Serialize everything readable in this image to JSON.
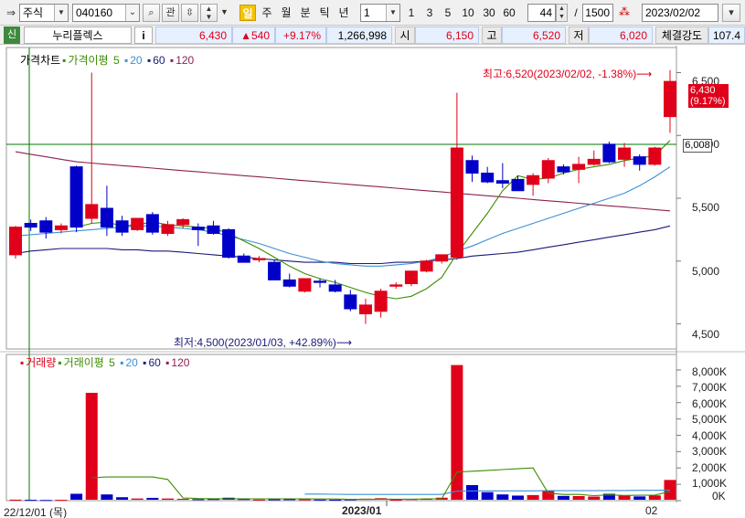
{
  "toolbar": {
    "market_type": "주식",
    "stock_code": "040160",
    "btn_gwan": "관",
    "periods": [
      "일",
      "주",
      "월",
      "분",
      "틱",
      "년"
    ],
    "active_period": "일",
    "interval_value": "1",
    "intervals": [
      "1",
      "3",
      "5",
      "10",
      "30",
      "60"
    ],
    "display_count": "44",
    "separator": "/",
    "total_count": "1500",
    "date": "2023/02/02"
  },
  "quote": {
    "badge": "신",
    "name": "누리플렉스",
    "info_btn": "i",
    "price": "6,430",
    "change": "▲540",
    "change_pct": "+9.17%",
    "volume": "1,266,998",
    "open_label": "시",
    "open": "6,150",
    "high_label": "고",
    "high": "6,520",
    "low_label": "저",
    "low": "6,020",
    "strength_label": "체결강도",
    "strength": "107.4"
  },
  "price_panel": {
    "legend_title": "가격차트",
    "legend_ma_label": "가격이평",
    "ma_periods": [
      "5",
      "20",
      "60",
      "120"
    ],
    "last_price": "6,430",
    "last_change_pct": "(9.17%)",
    "crosshair_value": "6,008",
    "max_annotation": "최고:6,520(2023/02/02, -1.38%)⟶",
    "min_annotation": "최저:4,500(2023/01/03, +42.89%)⟶",
    "y_ticks": [
      "6,500",
      "6,000",
      "5,500",
      "5,000",
      "4,500"
    ]
  },
  "volume_panel": {
    "legend_title": "거래량",
    "legend_ma_label": "거래이평",
    "ma_periods": [
      "5",
      "20",
      "60",
      "120"
    ],
    "y_ticks": [
      "8,000K",
      "7,000K",
      "6,000K",
      "5,000K",
      "4,000K",
      "3,000K",
      "2,000K",
      "1,000K",
      "0K"
    ]
  },
  "x_axis": {
    "start_label": "22/12/01 (목)",
    "month_label": "2023/01",
    "end_label": "02"
  },
  "colors": {
    "up": "#e0001a",
    "down": "#0000c8",
    "ma5": "#3c8c00",
    "ma20": "#3a8fd6",
    "ma60": "#1a1a7a",
    "ma120": "#8c2050",
    "crosshair": "#007a00"
  },
  "chart_data": {
    "type": "candlestick",
    "y_range": [
      4300,
      6700
    ],
    "volume_range": [
      0,
      8500000
    ],
    "candles": [
      {
        "o": 5050,
        "h": 5280,
        "l": 5020,
        "c": 5270
      },
      {
        "o": 5300,
        "h": 5330,
        "l": 5240,
        "c": 5270
      },
      {
        "o": 5320,
        "h": 5350,
        "l": 5180,
        "c": 5230
      },
      {
        "o": 5250,
        "h": 5300,
        "l": 5220,
        "c": 5280
      },
      {
        "o": 5750,
        "h": 5760,
        "l": 5230,
        "c": 5270
      },
      {
        "o": 5340,
        "h": 6500,
        "l": 5300,
        "c": 5450
      },
      {
        "o": 5420,
        "h": 5600,
        "l": 5200,
        "c": 5270
      },
      {
        "o": 5320,
        "h": 5360,
        "l": 5200,
        "c": 5230
      },
      {
        "o": 5250,
        "h": 5340,
        "l": 5240,
        "c": 5340
      },
      {
        "o": 5370,
        "h": 5390,
        "l": 5210,
        "c": 5230
      },
      {
        "o": 5220,
        "h": 5320,
        "l": 5200,
        "c": 5290
      },
      {
        "o": 5290,
        "h": 5340,
        "l": 5260,
        "c": 5330
      },
      {
        "o": 5270,
        "h": 5300,
        "l": 5120,
        "c": 5250
      },
      {
        "o": 5280,
        "h": 5320,
        "l": 5210,
        "c": 5220
      },
      {
        "o": 5250,
        "h": 5260,
        "l": 5020,
        "c": 5030
      },
      {
        "o": 5040,
        "h": 5060,
        "l": 4990,
        "c": 4990
      },
      {
        "o": 5010,
        "h": 5040,
        "l": 4990,
        "c": 5020
      },
      {
        "o": 4990,
        "h": 5010,
        "l": 4850,
        "c": 4850
      },
      {
        "o": 4850,
        "h": 4900,
        "l": 4790,
        "c": 4800
      },
      {
        "o": 4760,
        "h": 4860,
        "l": 4750,
        "c": 4860
      },
      {
        "o": 4840,
        "h": 4860,
        "l": 4790,
        "c": 4830
      },
      {
        "o": 4810,
        "h": 4850,
        "l": 4750,
        "c": 4760
      },
      {
        "o": 4730,
        "h": 4770,
        "l": 4600,
        "c": 4620
      },
      {
        "o": 4580,
        "h": 4700,
        "l": 4500,
        "c": 4650
      },
      {
        "o": 4600,
        "h": 4780,
        "l": 4550,
        "c": 4760
      },
      {
        "o": 4800,
        "h": 4830,
        "l": 4780,
        "c": 4810
      },
      {
        "o": 4820,
        "h": 4920,
        "l": 4800,
        "c": 4920
      },
      {
        "o": 4920,
        "h": 5010,
        "l": 4910,
        "c": 5000
      },
      {
        "o": 5000,
        "h": 5050,
        "l": 4980,
        "c": 5050
      },
      {
        "o": 5030,
        "h": 6340,
        "l": 5010,
        "c": 5900
      },
      {
        "o": 5800,
        "h": 5840,
        "l": 5630,
        "c": 5700
      },
      {
        "o": 5700,
        "h": 5750,
        "l": 5620,
        "c": 5630
      },
      {
        "o": 5640,
        "h": 5780,
        "l": 5580,
        "c": 5620
      },
      {
        "o": 5650,
        "h": 5680,
        "l": 5560,
        "c": 5560
      },
      {
        "o": 5610,
        "h": 5700,
        "l": 5520,
        "c": 5680
      },
      {
        "o": 5660,
        "h": 5820,
        "l": 5620,
        "c": 5800
      },
      {
        "o": 5750,
        "h": 5770,
        "l": 5690,
        "c": 5710
      },
      {
        "o": 5730,
        "h": 5830,
        "l": 5620,
        "c": 5770
      },
      {
        "o": 5770,
        "h": 5880,
        "l": 5760,
        "c": 5810
      },
      {
        "o": 5930,
        "h": 5950,
        "l": 5780,
        "c": 5790
      },
      {
        "o": 5810,
        "h": 5940,
        "l": 5750,
        "c": 5900
      },
      {
        "o": 5830,
        "h": 5850,
        "l": 5720,
        "c": 5770
      },
      {
        "o": 5770,
        "h": 5910,
        "l": 5760,
        "c": 5900
      },
      {
        "o": 6150,
        "h": 6520,
        "l": 6020,
        "c": 6430
      }
    ],
    "volume": [
      60000,
      50000,
      40000,
      50000,
      420000,
      6600000,
      380000,
      210000,
      130000,
      170000,
      130000,
      110000,
      90000,
      100000,
      180000,
      100000,
      70000,
      80000,
      90000,
      80000,
      70000,
      60000,
      80000,
      120000,
      150000,
      60000,
      100000,
      110000,
      180000,
      8300000,
      950000,
      520000,
      380000,
      310000,
      340000,
      610000,
      290000,
      280000,
      250000,
      420000,
      330000,
      260000,
      320000,
      1266998
    ],
    "ma5": [
      null,
      null,
      null,
      null,
      5270,
      5300,
      5310,
      5280,
      5290,
      5310,
      5290,
      5280,
      5270,
      5260,
      5220,
      5160,
      5100,
      5030,
      4960,
      4900,
      4860,
      4830,
      4790,
      4750,
      4720,
      4700,
      4720,
      4780,
      4870,
      5060,
      5220,
      5380,
      5560,
      5680,
      5650,
      5660,
      5700,
      5730,
      5750,
      5770,
      5800,
      5820,
      5840,
      5960
    ],
    "ma20": [
      5200,
      5210,
      5220,
      5230,
      5240,
      5250,
      5260,
      5270,
      5280,
      5280,
      5270,
      5260,
      5250,
      5230,
      5200,
      5170,
      5140,
      5100,
      5060,
      5030,
      5000,
      4980,
      4970,
      4960,
      4960,
      4970,
      4980,
      5000,
      5030,
      5080,
      5120,
      5170,
      5220,
      5260,
      5300,
      5340,
      5380,
      5420,
      5460,
      5500,
      5540,
      5600,
      5670,
      5750
    ],
    "ma60": [
      5060,
      5080,
      5090,
      5100,
      5100,
      5100,
      5100,
      5090,
      5090,
      5080,
      5080,
      5070,
      5060,
      5050,
      5040,
      5030,
      5020,
      5010,
      5000,
      4990,
      4990,
      4990,
      4980,
      4980,
      4980,
      4990,
      4990,
      5000,
      5010,
      5020,
      5040,
      5050,
      5060,
      5070,
      5090,
      5110,
      5130,
      5150,
      5170,
      5190,
      5210,
      5230,
      5250,
      5280
    ],
    "ma120": [
      5870,
      5850,
      5830,
      5810,
      5790,
      5780,
      5770,
      5760,
      5750,
      5740,
      5730,
      5720,
      5710,
      5700,
      5690,
      5680,
      5670,
      5660,
      5650,
      5640,
      5630,
      5620,
      5610,
      5600,
      5590,
      5580,
      5570,
      5560,
      5550,
      5540,
      5530,
      5520,
      5510,
      5500,
      5490,
      5480,
      5470,
      5460,
      5450,
      5440,
      5430,
      5420,
      5410,
      5400
    ],
    "vol_ma5": [
      null,
      null,
      null,
      null,
      null,
      1400000,
      1450000,
      1450000,
      1450000,
      1450000,
      1300000,
      170000,
      130000,
      120000,
      120000,
      110000,
      110000,
      110000,
      110000,
      110000,
      100000,
      100000,
      80000,
      80000,
      90000,
      90000,
      90000,
      110000,
      110000,
      1750000,
      1800000,
      1850000,
      1900000,
      1950000,
      2000000,
      460000,
      380000,
      380000,
      310000,
      350000,
      320000,
      330000,
      340000,
      560000
    ],
    "vol_ma20": [
      null,
      null,
      null,
      null,
      null,
      null,
      null,
      null,
      null,
      null,
      null,
      null,
      null,
      null,
      null,
      null,
      null,
      null,
      null,
      400000,
      400000,
      390000,
      380000,
      380000,
      380000,
      380000,
      380000,
      380000,
      380000,
      580000,
      590000,
      600000,
      600000,
      600000,
      600000,
      610000,
      610000,
      610000,
      610000,
      620000,
      620000,
      630000,
      630000,
      640000
    ]
  }
}
